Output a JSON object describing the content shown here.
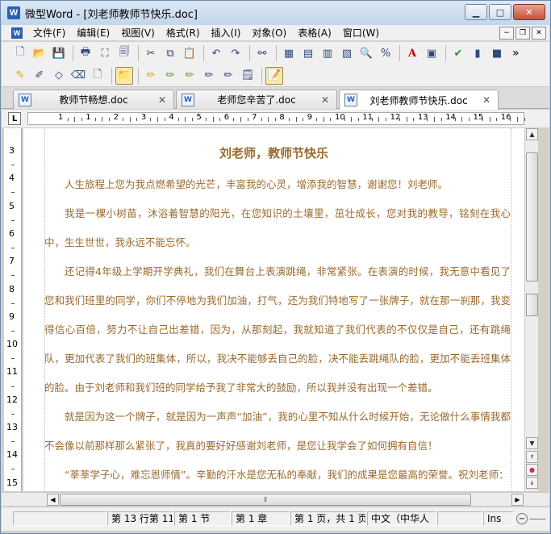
{
  "window": {
    "title": "微型Word - [刘老师教师节快乐.doc]",
    "app_icon": "W"
  },
  "menu": {
    "items": [
      "文件(F)",
      "编辑(E)",
      "视图(V)",
      "格式(R)",
      "插入(I)",
      "对象(O)",
      "表格(A)",
      "窗口(W)"
    ]
  },
  "toolbar1": {
    "icons": [
      "new-file-icon",
      "open-folder-icon",
      "save-icon",
      "print-icon",
      "pdf-icon",
      "print-preview-icon",
      "cut-icon",
      "copy-icon",
      "paste-icon",
      "undo-icon",
      "redo-icon",
      "binoculars-icon",
      "insert-table-icon",
      "table-icon",
      "layout-icon",
      "columns-icon",
      "zoom-icon",
      "percent-icon",
      "font-color-icon",
      "text-box-icon",
      "spellcheck-icon",
      "chart-icon",
      "shape-icon"
    ],
    "overflow": "»"
  },
  "toolbar2": {
    "icons": [
      "highlight-icon",
      "edit-pen-icon",
      "shape-pen-icon",
      "eraser-icon",
      "page-icon",
      "folder-active-icon",
      "pencil-icon",
      "pencil-2-icon",
      "pencil-3-icon",
      "pencil-4-icon",
      "pencil-5-icon",
      "notepad-icon",
      "doc-edit-icon"
    ]
  },
  "tabs": [
    {
      "label": "教师节畅想.doc",
      "active": false
    },
    {
      "label": "老师您辛苦了.doc",
      "active": false
    },
    {
      "label": "刘老师教师节快乐.doc",
      "active": true
    }
  ],
  "ruler": {
    "corner": "L",
    "numbers": [
      "1",
      "1",
      "2",
      "3",
      "4",
      "5",
      "6",
      "7",
      "8",
      "9",
      "10",
      "11",
      "12",
      "13",
      "14",
      "15",
      "16"
    ],
    "vnumbers": [
      "3",
      "4",
      "5",
      "6",
      "7",
      "8",
      "9",
      "10",
      "11",
      "12",
      "13",
      "14",
      "15"
    ]
  },
  "document": {
    "title": "刘老师，教师节快乐",
    "paragraphs": [
      "人生旅程上您为我点燃希望的光芒，丰富我的心灵，增添我的智慧，谢谢您！刘老师。",
      "我是一棵小树苗，沐浴着智慧的阳光，在您知识的土壤里，茁壮成长，您对我的教导，铭刻在我心中，生生世世，我永远不能忘怀。",
      "还记得4年级上学期开学典礼，我们在舞台上表演跳绳，非常紧张。在表演的时候，我无意中看见了您和我们班里的同学，你们不停地为我们加油，打气，还为我们特地写了一张牌子，就在那一刹那，我变得信心百倍，努力不让自己出差错，因为，从那刻起，我就知道了我们代表的不仅仅是自己，还有跳绳队，更加代表了我们的班集体，所以，我决不能够丢自己的脸，决不能丢跳绳队的脸，更加不能丢班集体的脸。由于刘老师和我们班的同学给予我了非常大的鼓励，所以我并没有出现一个差错。",
      "就是因为这一个牌子，就是因为一声声“加油”，我的心里不知从什么时候开始，无论做什么事情我都不会像以前那样那么紧张了，我真的要好好感谢刘老师，是您让我学会了如何拥有自信！",
      "“莘莘学子心，难忘恩师情”。辛勤的汗水是您无私的奉献，我们的成果是您最高的荣誉。祝刘老师："
    ]
  },
  "statusbar": {
    "cells": [
      "第 13 行第 11",
      "第 1 节",
      "第 1 章",
      "第 1 页，共 1 页",
      "中文（中华人",
      "",
      "Ins"
    ]
  },
  "colors": {
    "document_text": "#9a6a2e",
    "title_bar": "#dbe7f5"
  }
}
